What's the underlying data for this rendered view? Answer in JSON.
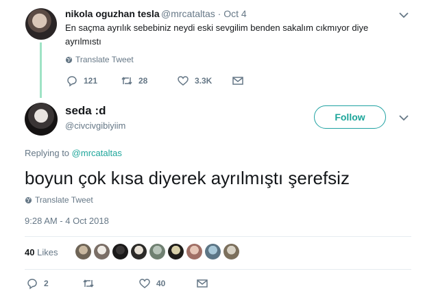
{
  "parent_tweet": {
    "name": "nikola oguzhan tesla",
    "handle_date": "@mrcataltas · Oct 4",
    "text": "En saçma ayrılık sebebiniz neydi eski sevgilim benden sakalım cıkmıyor diye ayrılmıstı",
    "translate_label": "Translate Tweet",
    "reply_count": "121",
    "retweet_count": "28",
    "like_count": "3.3K"
  },
  "main_tweet": {
    "name": "seda :d",
    "handle": "@civcivgibiyiim",
    "follow_label": "Follow",
    "replying_prefix": "Replying to",
    "replying_to": "@mrcataltas",
    "text": "boyun çok kısa diyerek ayrılmıştı şerefsiz",
    "translate_label": "Translate Tweet",
    "timestamp": "9:28 AM - 4 Oct 2018",
    "like_count": "40",
    "likes_label": "Likes",
    "reply_count": "2",
    "like_action_count": "40"
  },
  "likers": [
    {
      "name": "liker-1",
      "colors": [
        "#c9b8a0",
        "#6e6456"
      ]
    },
    {
      "name": "liker-2",
      "colors": [
        "#f0ece6",
        "#7a6e66"
      ]
    },
    {
      "name": "liker-3",
      "colors": [
        "#3a3737",
        "#1b1a1a"
      ]
    },
    {
      "name": "liker-4",
      "colors": [
        "#e7e0d5",
        "#2b2a28"
      ]
    },
    {
      "name": "liker-5",
      "colors": [
        "#b8c5ba",
        "#6f8071"
      ]
    },
    {
      "name": "liker-6",
      "colors": [
        "#d8cfa8",
        "#1f1d1a"
      ]
    },
    {
      "name": "liker-7",
      "colors": [
        "#e7c7b8",
        "#a06f66"
      ]
    },
    {
      "name": "liker-8",
      "colors": [
        "#a9c8d8",
        "#5c7585"
      ]
    },
    {
      "name": "liker-9",
      "colors": [
        "#d8d2c5",
        "#7b6f5c"
      ]
    }
  ],
  "colors": {
    "accent": "#1ca59a",
    "thread_line": "#9fe3c5",
    "secondary_text": "#657786",
    "primary_text": "#14171a"
  },
  "icons": {
    "reply": "reply-icon",
    "retweet": "retweet-icon",
    "like": "heart-icon",
    "dm": "envelope-icon",
    "menu": "chevron-down-icon",
    "translate": "globe-icon"
  }
}
